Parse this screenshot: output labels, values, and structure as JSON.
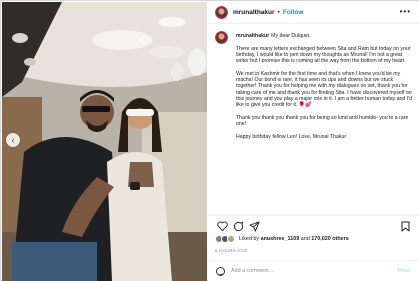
{
  "post": {
    "username": "mrunalthakur",
    "follow_label": "Follow",
    "separator": "•",
    "more_icon": "more-horizontal-icon"
  },
  "caption": {
    "username": "mrunalthakur",
    "paragraphs": [
      "My dear Dulquer,",
      "There are many letters exchanged between Sita and Ram but today on your birthday, I would like to pen down my thoughts as Mrunal! I'm not a great writer but I promise this is coming all the way from the bottom of my heart.",
      "We met in Kashmir for the first time and that's when I knew you'd be my macha! Our bond is rare, it has seen its ups and downs but we stuck together! Thank you for helping me with my dialogues on set, thank you for taking care of me and thank you for finding Sita. I have discovered myself on this journey and you play a major role in it. I am a better human today and I'd like to give you credit for it. 🌹💕",
      "Thank you thank you thank you for being so kind and humble- you're a rare one!",
      "Happy birthday fellow Leo! Love, Mrunal Thakur."
    ]
  },
  "actions": {
    "like_icon": "heart-icon",
    "comment_icon": "comment-icon",
    "share_icon": "share-icon",
    "save_icon": "bookmark-icon"
  },
  "likes": {
    "prefix": "Liked by ",
    "user": "anushree_1109",
    "middle": " and ",
    "count": "170,020 others"
  },
  "timestamp": "6 HOURS AGO",
  "comment": {
    "placeholder": "Add a comment...",
    "post_label": "Post"
  },
  "colors": {
    "accent": "#0095f6",
    "post_disabled": "#b2dffc"
  }
}
